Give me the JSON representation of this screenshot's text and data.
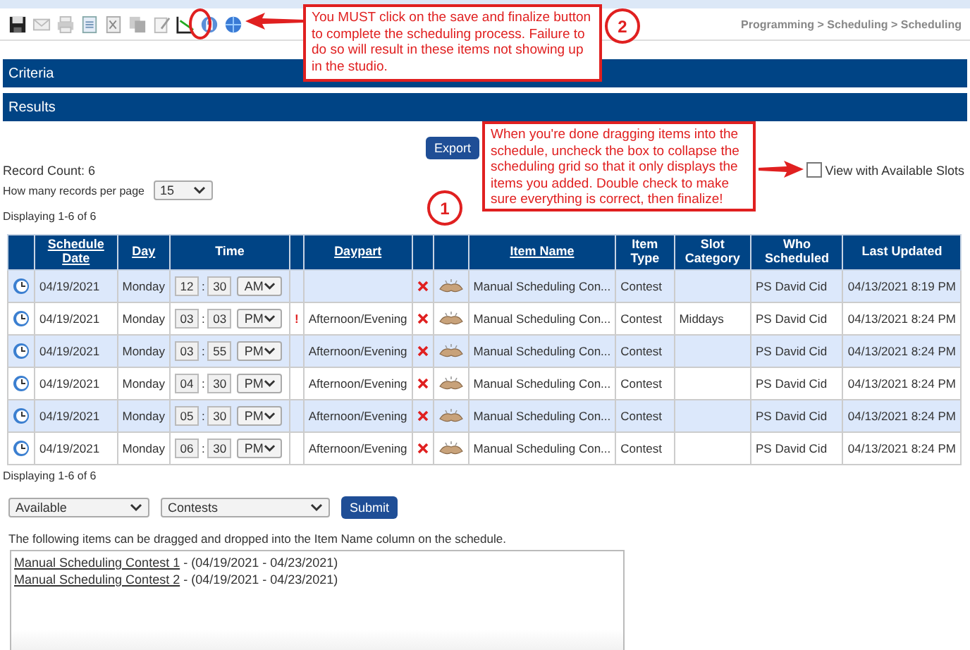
{
  "breadcrumb": "Programming > Scheduling > Scheduling",
  "sections": [
    {
      "title": "Criteria"
    },
    {
      "title": "Results"
    }
  ],
  "export_button": "Export",
  "record_count": "Record Count: 6",
  "per_page": {
    "label": "How many records per page",
    "value": "15"
  },
  "view_available": {
    "label": "View with Available Slots",
    "checked": false
  },
  "displaying_top": "Displaying 1-6 of 6",
  "table": {
    "columns": [
      {
        "kind": "blank"
      },
      {
        "kind": "label",
        "label": "Schedule Date",
        "sortable": true
      },
      {
        "kind": "label",
        "label": "Day",
        "sortable": true
      },
      {
        "kind": "label",
        "label": "Time",
        "sortable": false
      },
      {
        "kind": "blank"
      },
      {
        "kind": "label",
        "label": "Daypart",
        "sortable": true
      },
      {
        "kind": "blank"
      },
      {
        "kind": "blank"
      },
      {
        "kind": "label",
        "label": "Item Name",
        "sortable": true
      },
      {
        "kind": "label",
        "label": "Item Type",
        "sortable": false
      },
      {
        "kind": "label",
        "label": "Slot Category",
        "sortable": false
      },
      {
        "kind": "label",
        "label": "Who Scheduled",
        "sortable": false
      },
      {
        "kind": "label",
        "label": "Last Updated",
        "sortable": false
      }
    ],
    "time_separator": ":",
    "rows": [
      {
        "date": "04/19/2021",
        "day": "Monday",
        "hour": "12",
        "minute": "30",
        "ampm": "AM",
        "warning": "",
        "daypart": "",
        "item_name": "Manual Scheduling Con...",
        "item_type": "Contest",
        "slot_category": "",
        "who": "PS David Cid",
        "updated": "04/13/2021 8:19 PM"
      },
      {
        "date": "04/19/2021",
        "day": "Monday",
        "hour": "03",
        "minute": "03",
        "ampm": "PM",
        "warning": "!",
        "daypart": "Afternoon/Evening",
        "item_name": "Manual Scheduling Con...",
        "item_type": "Contest",
        "slot_category": "Middays",
        "who": "PS David Cid",
        "updated": "04/13/2021 8:24 PM"
      },
      {
        "date": "04/19/2021",
        "day": "Monday",
        "hour": "03",
        "minute": "55",
        "ampm": "PM",
        "warning": "",
        "daypart": "Afternoon/Evening",
        "item_name": "Manual Scheduling Con...",
        "item_type": "Contest",
        "slot_category": "",
        "who": "PS David Cid",
        "updated": "04/13/2021 8:24 PM"
      },
      {
        "date": "04/19/2021",
        "day": "Monday",
        "hour": "04",
        "minute": "30",
        "ampm": "PM",
        "warning": "",
        "daypart": "Afternoon/Evening",
        "item_name": "Manual Scheduling Con...",
        "item_type": "Contest",
        "slot_category": "",
        "who": "PS David Cid",
        "updated": "04/13/2021 8:24 PM"
      },
      {
        "date": "04/19/2021",
        "day": "Monday",
        "hour": "05",
        "minute": "30",
        "ampm": "PM",
        "warning": "",
        "daypart": "Afternoon/Evening",
        "item_name": "Manual Scheduling Con...",
        "item_type": "Contest",
        "slot_category": "",
        "who": "PS David Cid",
        "updated": "04/13/2021 8:24 PM"
      },
      {
        "date": "04/19/2021",
        "day": "Monday",
        "hour": "06",
        "minute": "30",
        "ampm": "PM",
        "warning": "",
        "daypart": "Afternoon/Evening",
        "item_name": "Manual Scheduling Con...",
        "item_type": "Contest",
        "slot_category": "",
        "who": "PS David Cid",
        "updated": "04/13/2021 8:24 PM"
      }
    ]
  },
  "displaying_bottom": "Displaying 1-6 of 6",
  "filters": {
    "status": "Available",
    "type": "Contests",
    "submit": "Submit"
  },
  "drag_hint": "The following items can be dragged and dropped into the Item Name column on the schedule.",
  "available_items": [
    {
      "name": "Manual Scheduling Contest 1",
      "dates": " - (04/19/2021 - 04/23/2021)"
    },
    {
      "name": "Manual Scheduling Contest 2",
      "dates": " - (04/19/2021 - 04/23/2021)"
    }
  ],
  "callouts": [
    {
      "number": "2",
      "text": "You MUST click on the save and finalize button to complete the scheduling process. Failure to do so will result in these items not showing up in the studio."
    },
    {
      "number": "1",
      "text": "When you're done dragging items into the schedule, uncheck the box to collapse the scheduling grid so that it only displays the items you added. Double check to make sure everything is correct, then finalize!"
    }
  ]
}
